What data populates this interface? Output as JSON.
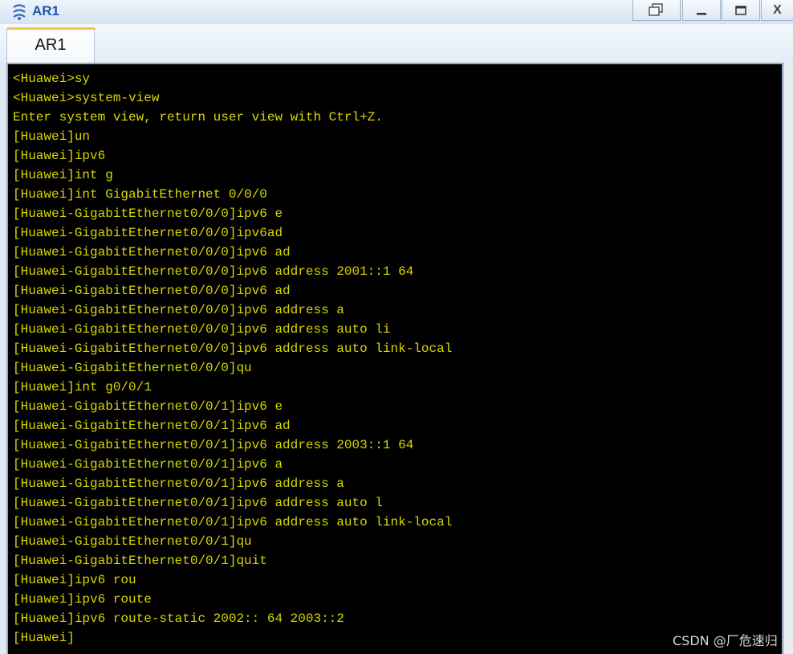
{
  "window": {
    "title": "AR1",
    "buttons": {
      "close": "X"
    }
  },
  "tabs": [
    {
      "label": "AR1",
      "active": true
    }
  ],
  "terminal": {
    "text_color": "#d7d700",
    "background": "#000000",
    "lines": [
      "<Huawei>sy",
      "<Huawei>system-view",
      "Enter system view, return user view with Ctrl+Z.",
      "[Huawei]un",
      "[Huawei]ipv6",
      "[Huawei]int g",
      "[Huawei]int GigabitEthernet 0/0/0",
      "[Huawei-GigabitEthernet0/0/0]ipv6 e",
      "[Huawei-GigabitEthernet0/0/0]ipv6ad",
      "[Huawei-GigabitEthernet0/0/0]ipv6 ad",
      "[Huawei-GigabitEthernet0/0/0]ipv6 address 2001::1 64",
      "[Huawei-GigabitEthernet0/0/0]ipv6 ad",
      "[Huawei-GigabitEthernet0/0/0]ipv6 address a",
      "[Huawei-GigabitEthernet0/0/0]ipv6 address auto li",
      "[Huawei-GigabitEthernet0/0/0]ipv6 address auto link-local",
      "[Huawei-GigabitEthernet0/0/0]qu",
      "[Huawei]int g0/0/1",
      "[Huawei-GigabitEthernet0/0/1]ipv6 e",
      "[Huawei-GigabitEthernet0/0/1]ipv6 ad",
      "[Huawei-GigabitEthernet0/0/1]ipv6 address 2003::1 64",
      "[Huawei-GigabitEthernet0/0/1]ipv6 a",
      "[Huawei-GigabitEthernet0/0/1]ipv6 address a",
      "[Huawei-GigabitEthernet0/0/1]ipv6 address auto l",
      "[Huawei-GigabitEthernet0/0/1]ipv6 address auto link-local",
      "[Huawei-GigabitEthernet0/0/1]qu",
      "[Huawei-GigabitEthernet0/0/1]quit",
      "[Huawei]ipv6 rou",
      "[Huawei]ipv6 route",
      "[Huawei]ipv6 route-static 2002:: 64 2003::2",
      "[Huawei]"
    ]
  },
  "watermark": "CSDN @厂危速归"
}
